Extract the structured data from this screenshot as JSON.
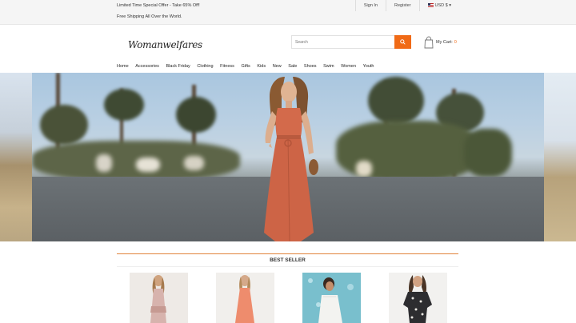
{
  "topbar": {
    "promo_line1": "Limited Time Special Offer - Take 65% Off!",
    "promo_line2": "Free Shipping All Over the World.",
    "sign_in": "Sign In",
    "register": "Register",
    "currency": "USD $ ▾"
  },
  "header": {
    "logo_text": "Womanwelfares",
    "search_placeholder": "Search",
    "cart_label": "My Cart:",
    "cart_count": "0"
  },
  "nav": {
    "items": [
      "Home",
      "Accessories",
      "Black Friday",
      "Clothing",
      "Fitness",
      "Gifts",
      "Kids",
      "New",
      "Sale",
      "Shoes",
      "Swim",
      "Women",
      "Youth"
    ]
  },
  "section": {
    "title": "BEST SELLER"
  },
  "colors": {
    "accent": "#f06a16",
    "hero_dress": "#d2694a"
  },
  "icons": {
    "search": "search-icon",
    "cart": "shopping-bag-icon"
  }
}
